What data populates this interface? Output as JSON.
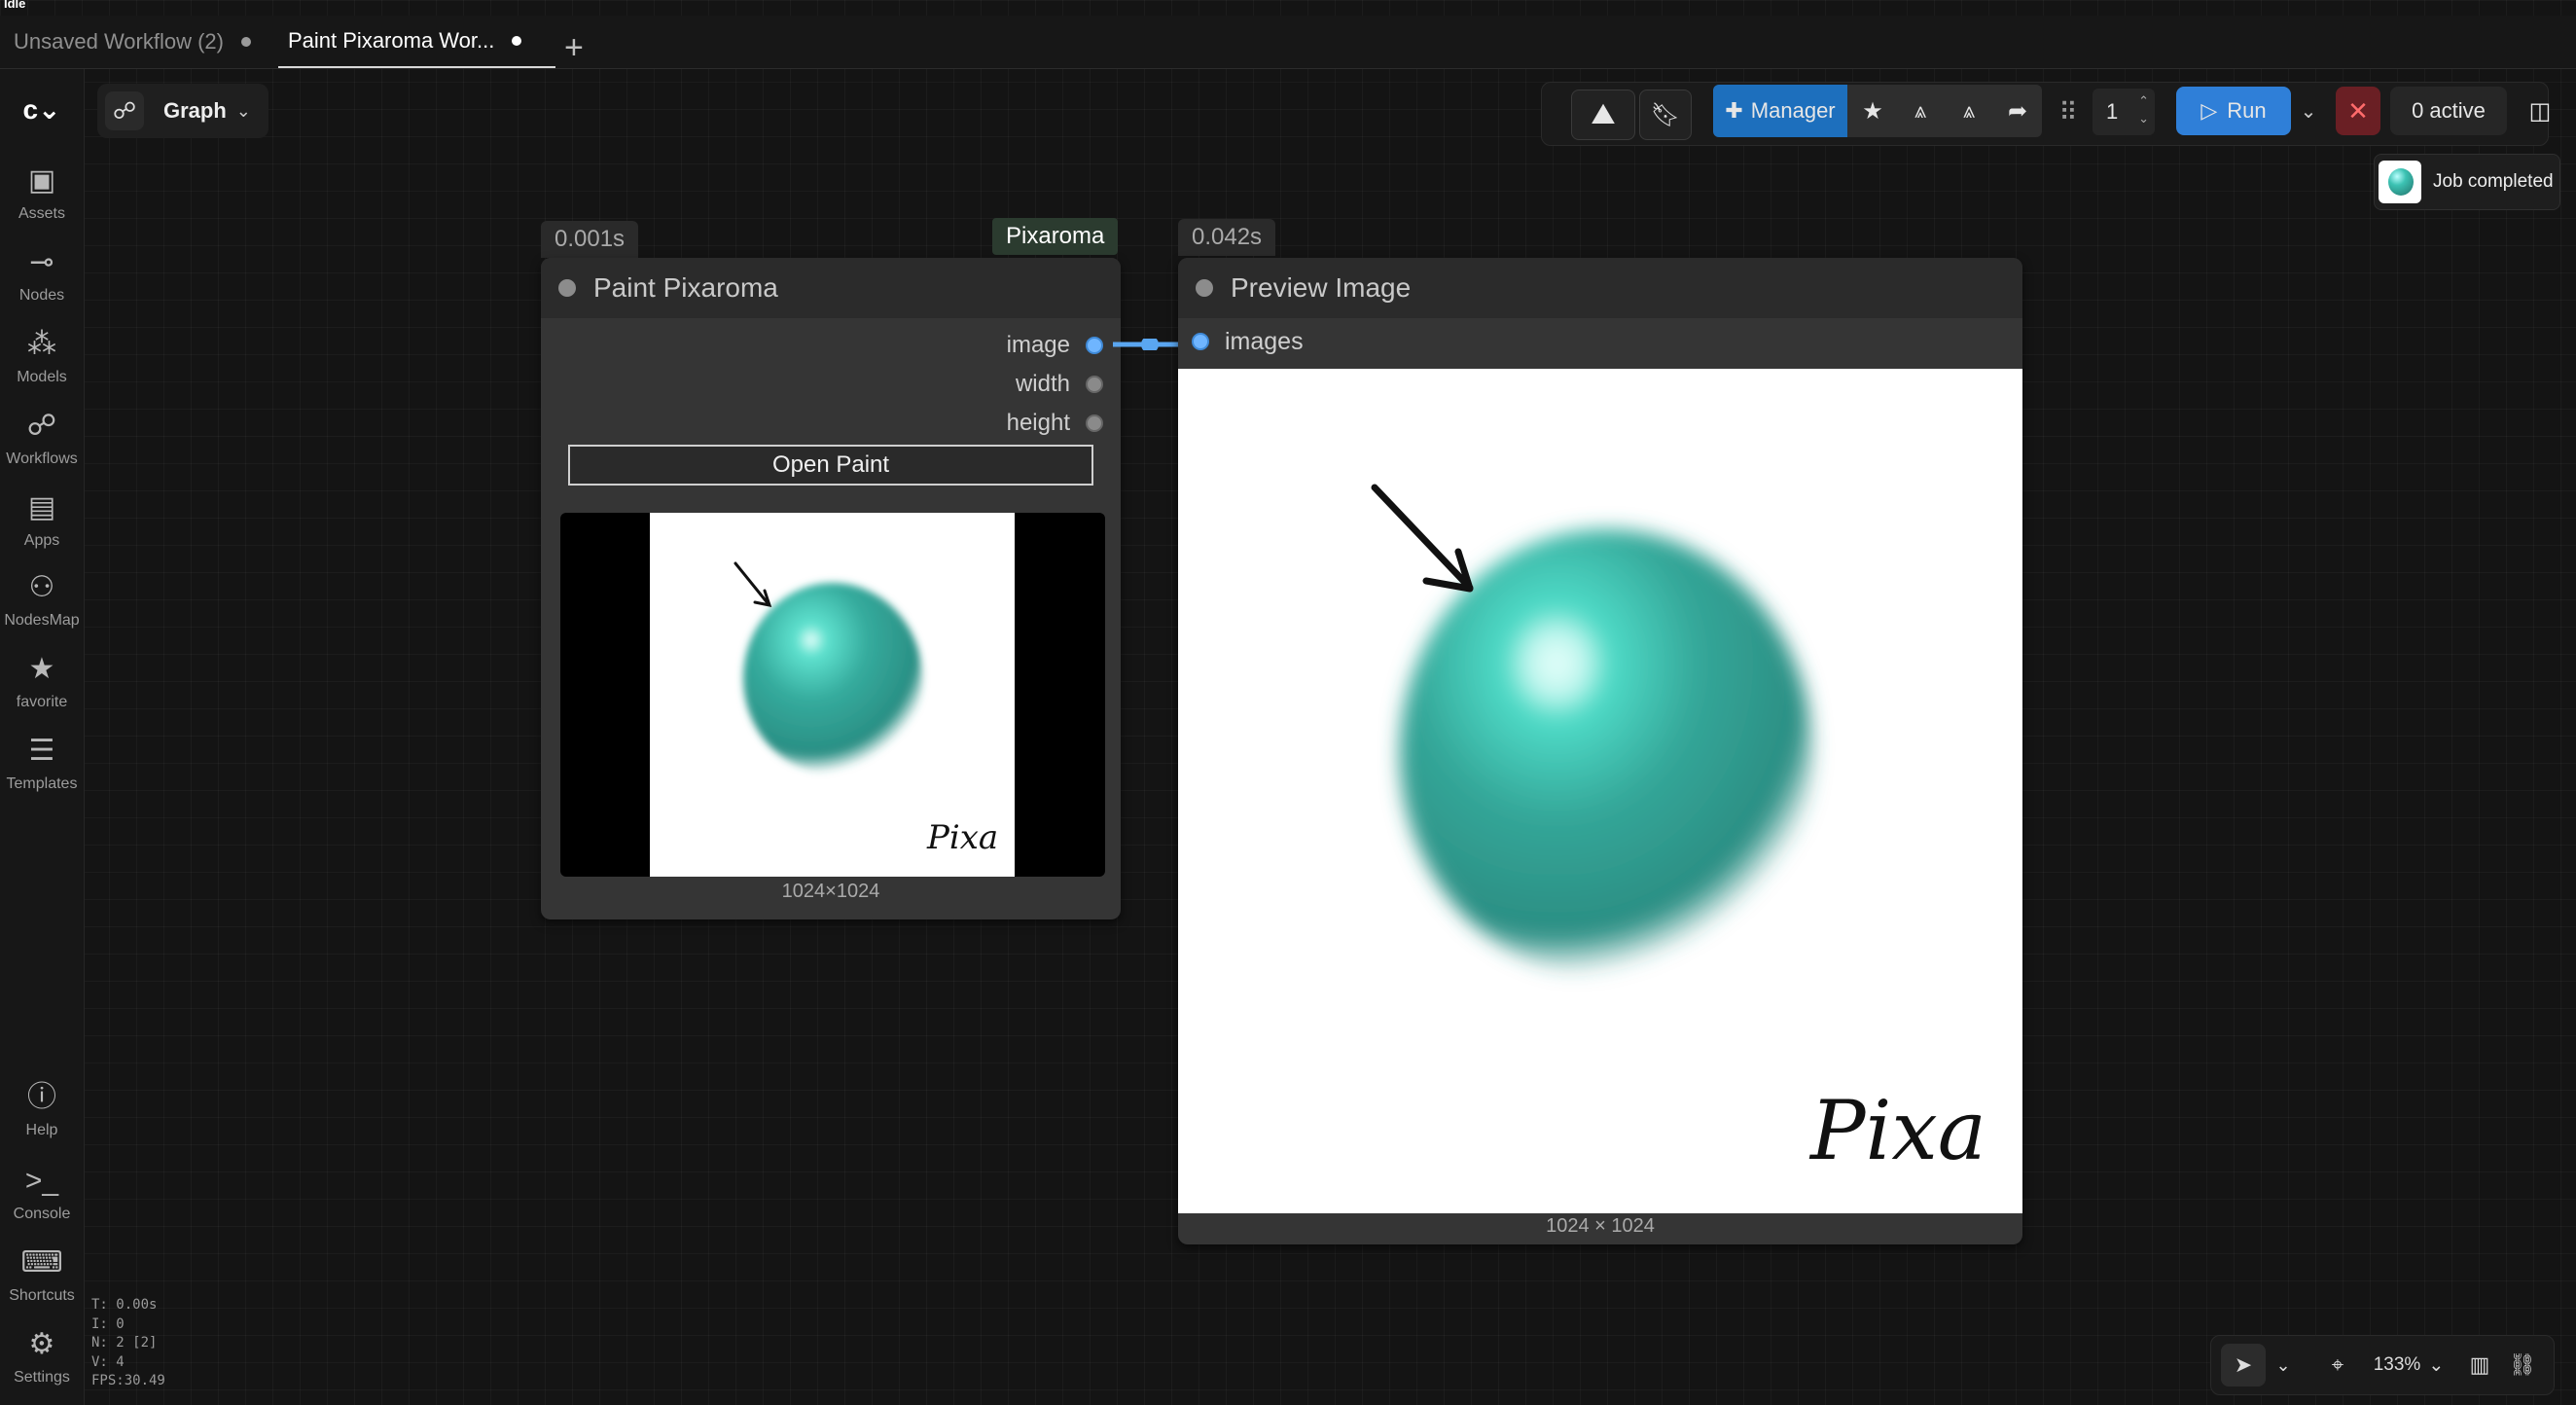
{
  "status": "Idle",
  "tabs": [
    {
      "label": "Unsaved Workflow (2)",
      "active": false
    },
    {
      "label": "Paint Pixaroma Wor...",
      "active": true
    }
  ],
  "sidebar": {
    "items": [
      {
        "label": "Assets",
        "icon": "image-icon"
      },
      {
        "label": "Nodes",
        "icon": "node-icon"
      },
      {
        "label": "Models",
        "icon": "models-icon"
      },
      {
        "label": "Workflows",
        "icon": "workflow-icon"
      },
      {
        "label": "Apps",
        "icon": "apps-icon"
      },
      {
        "label": "NodesMap",
        "icon": "nodesmap-icon"
      },
      {
        "label": "favorite",
        "icon": "star-icon"
      },
      {
        "label": "Templates",
        "icon": "templates-icon"
      }
    ],
    "bottom_items": [
      {
        "label": "Help",
        "icon": "help-icon"
      },
      {
        "label": "Console",
        "icon": "terminal-icon"
      },
      {
        "label": "Shortcuts",
        "icon": "keyboard-icon"
      },
      {
        "label": "Settings",
        "icon": "gear-icon"
      }
    ]
  },
  "view_mode": {
    "label": "Graph"
  },
  "toolbar": {
    "manager_label": "Manager",
    "queue_count": "1",
    "run_label": "Run",
    "active_label": "0 active"
  },
  "toast": {
    "text": "Job completed"
  },
  "nodes": {
    "paint": {
      "time": "0.001s",
      "badge": "Pixaroma",
      "title": "Paint Pixaroma",
      "outputs": [
        "image",
        "width",
        "height"
      ],
      "button_label": "Open Paint",
      "image_size": "1024×1024",
      "signature": "Pixa"
    },
    "preview": {
      "time": "0.042s",
      "title": "Preview Image",
      "input": "images",
      "image_size": "1024 × 1024",
      "signature": "Pixa"
    }
  },
  "stats": {
    "t": "T: 0.00s",
    "i": "I: 0",
    "n": "N: 2 [2]",
    "v": "V: 4",
    "fps": "FPS:30.49"
  },
  "canvas_controls": {
    "zoom": "133%"
  }
}
